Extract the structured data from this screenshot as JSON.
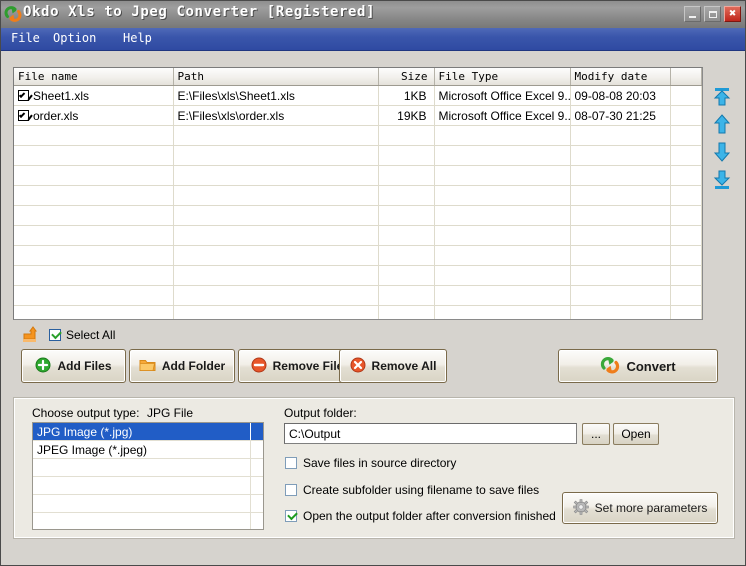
{
  "window": {
    "title": "Okdo Xls to Jpeg Converter [Registered]",
    "icon": "convert-arrows-icon",
    "minimize_label": "Minimize",
    "maximize_label": "Maximize",
    "close_label": "✖",
    "accent_titlebar": "#8f8f8f",
    "accent_menubar": "#3a56ab",
    "accent_selection": "#215dc6"
  },
  "menu": {
    "items": [
      {
        "label": "File"
      },
      {
        "label": "Option"
      },
      {
        "label": "Help"
      }
    ]
  },
  "file_list": {
    "columns": [
      "File name",
      "Path",
      "Size",
      "File Type",
      "Modify date",
      ""
    ],
    "rows": [
      {
        "checked": true,
        "name": "Sheet1.xls",
        "path": "E:\\Files\\xls\\Sheet1.xls",
        "size": "1KB",
        "type": "Microsoft Office Excel 9...",
        "modified": "09-08-08 20:03"
      },
      {
        "checked": true,
        "name": "order.xls",
        "path": "E:\\Files\\xls\\order.xls",
        "size": "19KB",
        "type": "Microsoft Office Excel 9...",
        "modified": "08-07-30 21:25"
      }
    ],
    "empty_row_count": 12
  },
  "order_buttons": [
    {
      "name": "move-to-top-icon",
      "tooltip": "Move to top"
    },
    {
      "name": "move-up-icon",
      "tooltip": "Move up"
    },
    {
      "name": "move-down-icon",
      "tooltip": "Move down"
    },
    {
      "name": "move-to-bottom-icon",
      "tooltip": "Move to bottom"
    }
  ],
  "toolbar": {
    "up_folder_icon": "up-folder-icon",
    "select_all_label": "Select All",
    "select_all_checked": true,
    "add_files_label": "Add Files",
    "add_folder_label": "Add Folder",
    "remove_file_label": "Remove File",
    "remove_all_label": "Remove All",
    "convert_label": "Convert"
  },
  "output_panel": {
    "choose_type_label": "Choose output type:",
    "choose_type_value": "JPG File",
    "type_options": [
      {
        "label": "JPG Image (*.jpg)",
        "selected": true
      },
      {
        "label": "JPEG Image (*.jpeg)",
        "selected": false
      }
    ],
    "output_folder_label": "Output folder:",
    "output_folder_value": "C:\\Output",
    "output_folder_placeholder": "C:\\Output",
    "browse_label": "...",
    "open_label": "Open",
    "checkboxes": [
      {
        "label": "Save files in source directory",
        "checked": false
      },
      {
        "label": "Create subfolder using filename to save files",
        "checked": false
      },
      {
        "label": "Open the output folder after conversion finished",
        "checked": true
      }
    ],
    "set_more_label": "Set more parameters"
  }
}
